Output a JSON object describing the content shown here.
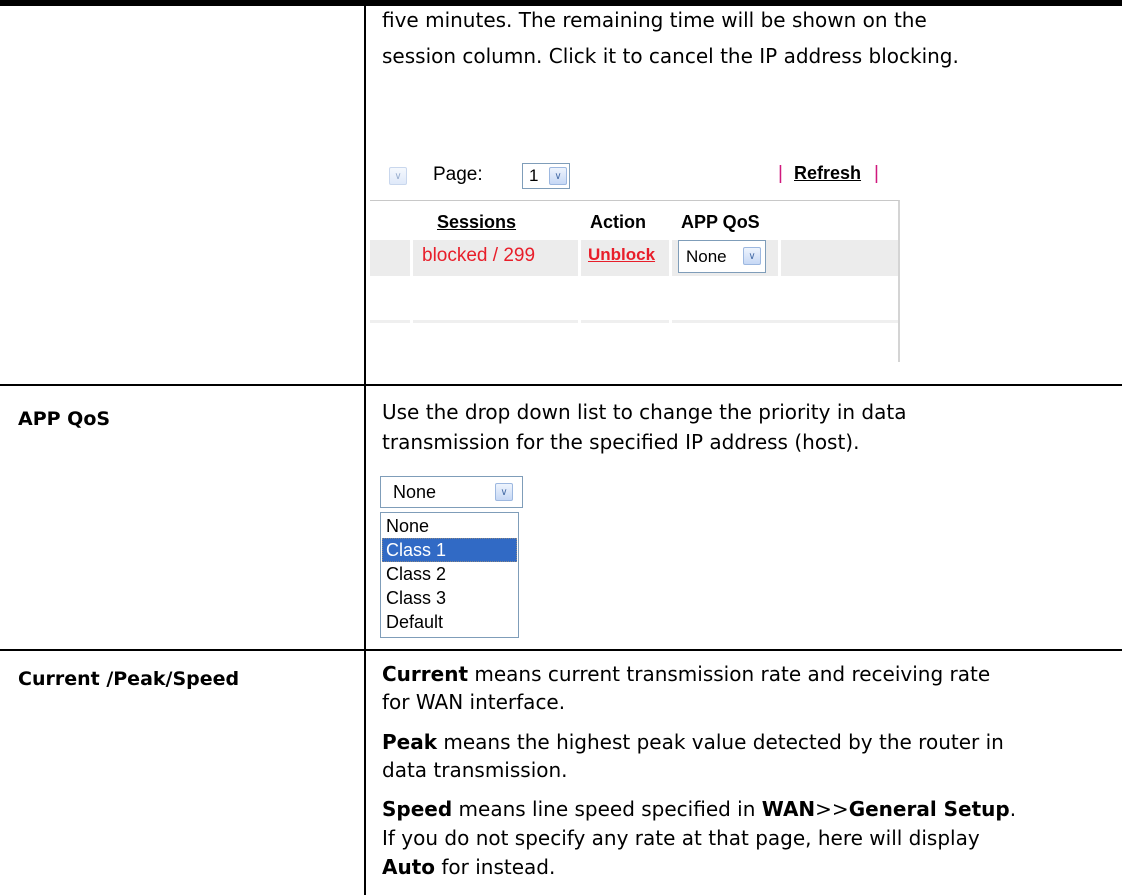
{
  "rows": [
    {
      "term": "",
      "description_lines": [
        "five minutes. The remaining time will be shown on the",
        "session column. Click it to cancel the IP address blocking."
      ]
    },
    {
      "term": "APP QoS",
      "description_lines": [
        "Use the drop down list to change the priority in data",
        "transmission for the specified IP address (host)."
      ]
    },
    {
      "term": "Current /Peak/Speed",
      "paragraphs": [
        {
          "line1_bold": "Current",
          "line1_rest": " means current transmission rate and receiving rate",
          "line2": "for WAN interface."
        },
        {
          "line1_bold": "Peak",
          "line1_rest": " means the highest peak value detected by the router in",
          "line2": "data transmission."
        },
        {
          "line1_bold": "Speed",
          "line1_mid": " means line speed specified in ",
          "line1_b2": "WAN",
          "line1_sep": ">>",
          "line1_b3": "General Setup",
          "line1_end": ".",
          "line2": "If you do not specify any rate at that page, here will display",
          "line3_bold": "Auto",
          "line3_rest": " for instead."
        }
      ]
    }
  ],
  "session_screenshot": {
    "page_label": "Page:",
    "page_value": "1",
    "pipe": "|",
    "refresh_label": "Refresh",
    "headers": {
      "sessions": "Sessions",
      "action": "Action",
      "app_qos": "APP QoS"
    },
    "row": {
      "sessions": "blocked / 299",
      "action": "Unblock",
      "app_qos": "None"
    },
    "arrow_icon": "chevron-down-icon"
  },
  "dropdown_screenshot": {
    "selected": "None",
    "options": [
      "None",
      "Class 1",
      "Class 2",
      "Class 3",
      "Default"
    ],
    "highlighted_option": "Class 1",
    "highlight_color": "#316ac5"
  },
  "colors": {
    "link_red": "#e81e2a",
    "pipe_pink": "#d0187d",
    "border": "#000000"
  }
}
